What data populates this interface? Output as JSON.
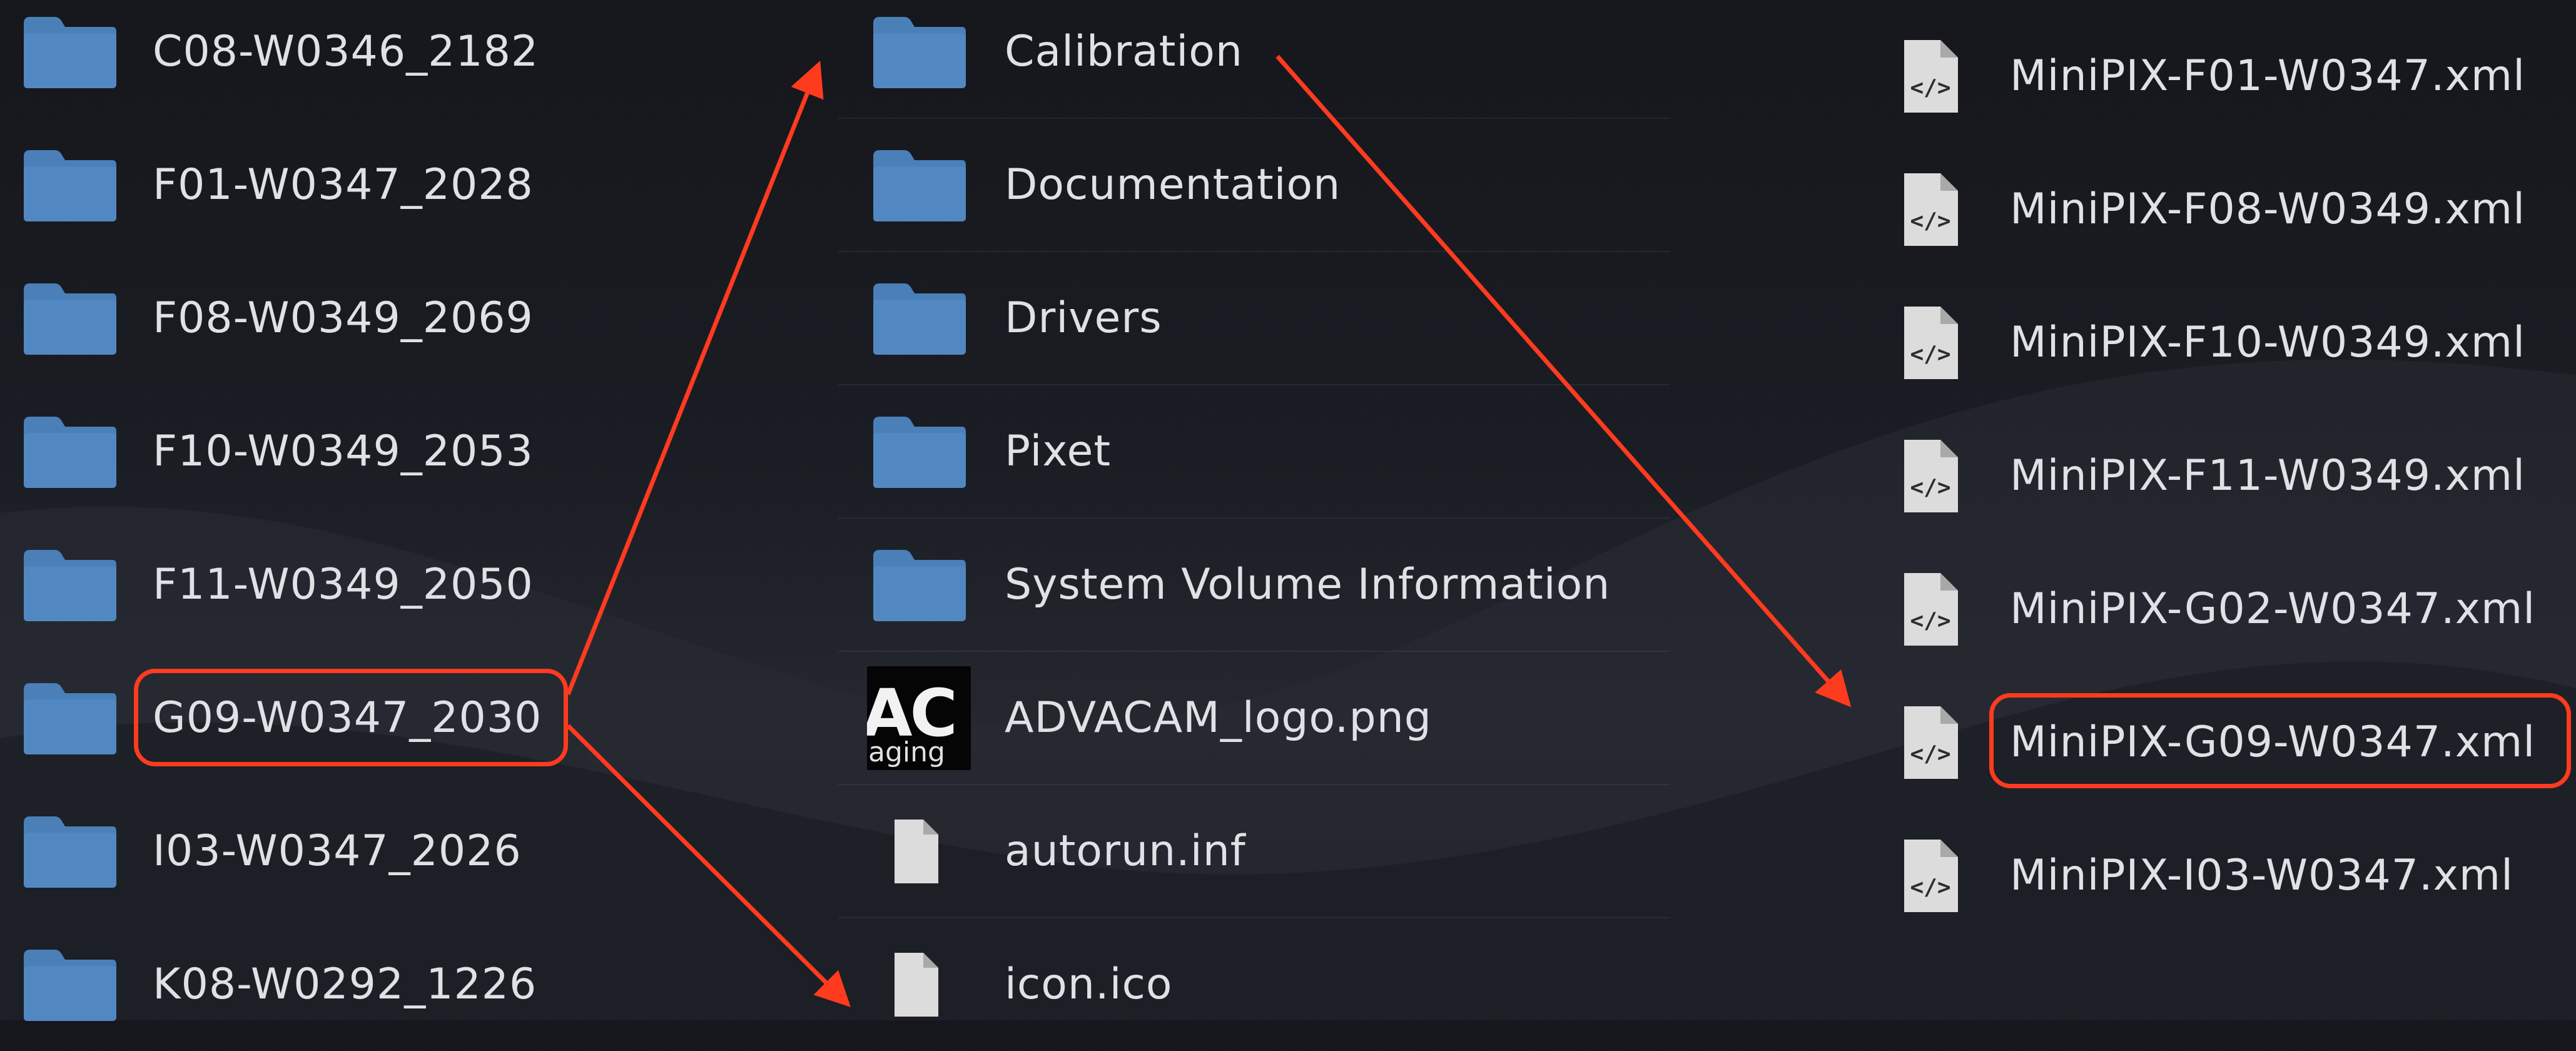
{
  "left_column": {
    "items": [
      {
        "label": "C08-W0346_2182",
        "icon": "folder-icon"
      },
      {
        "label": "F01-W0347_2028",
        "icon": "folder-icon"
      },
      {
        "label": "F08-W0349_2069",
        "icon": "folder-icon"
      },
      {
        "label": "F10-W0349_2053",
        "icon": "folder-icon"
      },
      {
        "label": "F11-W0349_2050",
        "icon": "folder-icon"
      },
      {
        "label": "G09-W0347_2030",
        "icon": "folder-icon",
        "highlighted": true
      },
      {
        "label": "I03-W0347_2026",
        "icon": "folder-icon"
      },
      {
        "label": "K08-W0292_1226",
        "icon": "folder-icon"
      }
    ]
  },
  "middle_column": {
    "items": [
      {
        "label": "Calibration",
        "icon": "folder-icon"
      },
      {
        "label": "Documentation",
        "icon": "folder-icon"
      },
      {
        "label": "Drivers",
        "icon": "folder-icon"
      },
      {
        "label": "Pixet",
        "icon": "folder-icon"
      },
      {
        "label": "System Volume Information",
        "icon": "folder-icon"
      },
      {
        "label": "ADVACAM_logo.png",
        "icon": "image-thumbnail",
        "thumb_text_1": "AC",
        "thumb_text_2": "aging"
      },
      {
        "label": "autorun.inf",
        "icon": "document-icon"
      },
      {
        "label": "icon.ico",
        "icon": "document-icon"
      }
    ]
  },
  "right_column": {
    "items": [
      {
        "label": "MiniPIX-F01-W0347.xml",
        "icon": "xml-file-icon"
      },
      {
        "label": "MiniPIX-F08-W0349.xml",
        "icon": "xml-file-icon"
      },
      {
        "label": "MiniPIX-F10-W0349.xml",
        "icon": "xml-file-icon"
      },
      {
        "label": "MiniPIX-F11-W0349.xml",
        "icon": "xml-file-icon"
      },
      {
        "label": "MiniPIX-G02-W0347.xml",
        "icon": "xml-file-icon"
      },
      {
        "label": "MiniPIX-G09-W0347.xml",
        "icon": "xml-file-icon",
        "highlighted": true
      },
      {
        "label": "MiniPIX-I03-W0347.xml",
        "icon": "xml-file-icon"
      }
    ]
  },
  "colors": {
    "folder": "#4a7fb8",
    "annotation": "#ff3b1f",
    "text": "#dfe1e5",
    "file_icon": "#dcdcdc"
  }
}
